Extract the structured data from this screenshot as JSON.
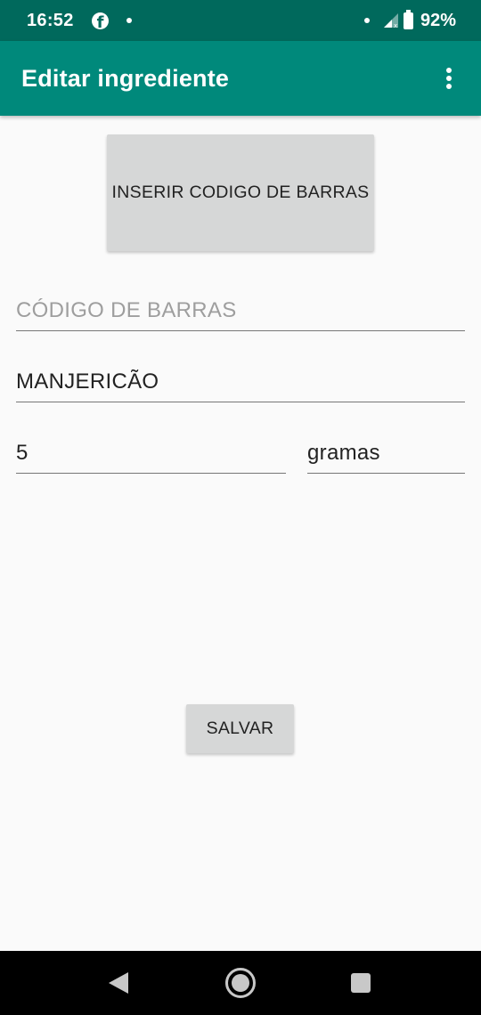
{
  "status_bar": {
    "time": "16:52",
    "battery": "92%",
    "icons": [
      "facebook-icon",
      "notification-dot-icon",
      "signal-icon",
      "battery-icon"
    ]
  },
  "app_bar": {
    "title": "Editar ingrediente",
    "menu_icon": "more-vert-icon",
    "background": "#00897b"
  },
  "form": {
    "barcode_button_label": "INSERIR CODIGO DE BARRAS",
    "barcode_field": {
      "value": "",
      "placeholder": "CÓDIGO DE BARRAS"
    },
    "name_field": {
      "value": "MANJERICÃO"
    },
    "quantity_field": {
      "value": "5"
    },
    "unit_field": {
      "value": "gramas"
    },
    "save_label": "SALVAR"
  },
  "nav_bar": {
    "buttons": [
      "back-icon",
      "home-icon",
      "recents-icon"
    ]
  },
  "colors": {
    "status_bar": "#00695c",
    "app_bar": "#00897b",
    "button": "#d6d7d7",
    "background": "#fafafa"
  }
}
